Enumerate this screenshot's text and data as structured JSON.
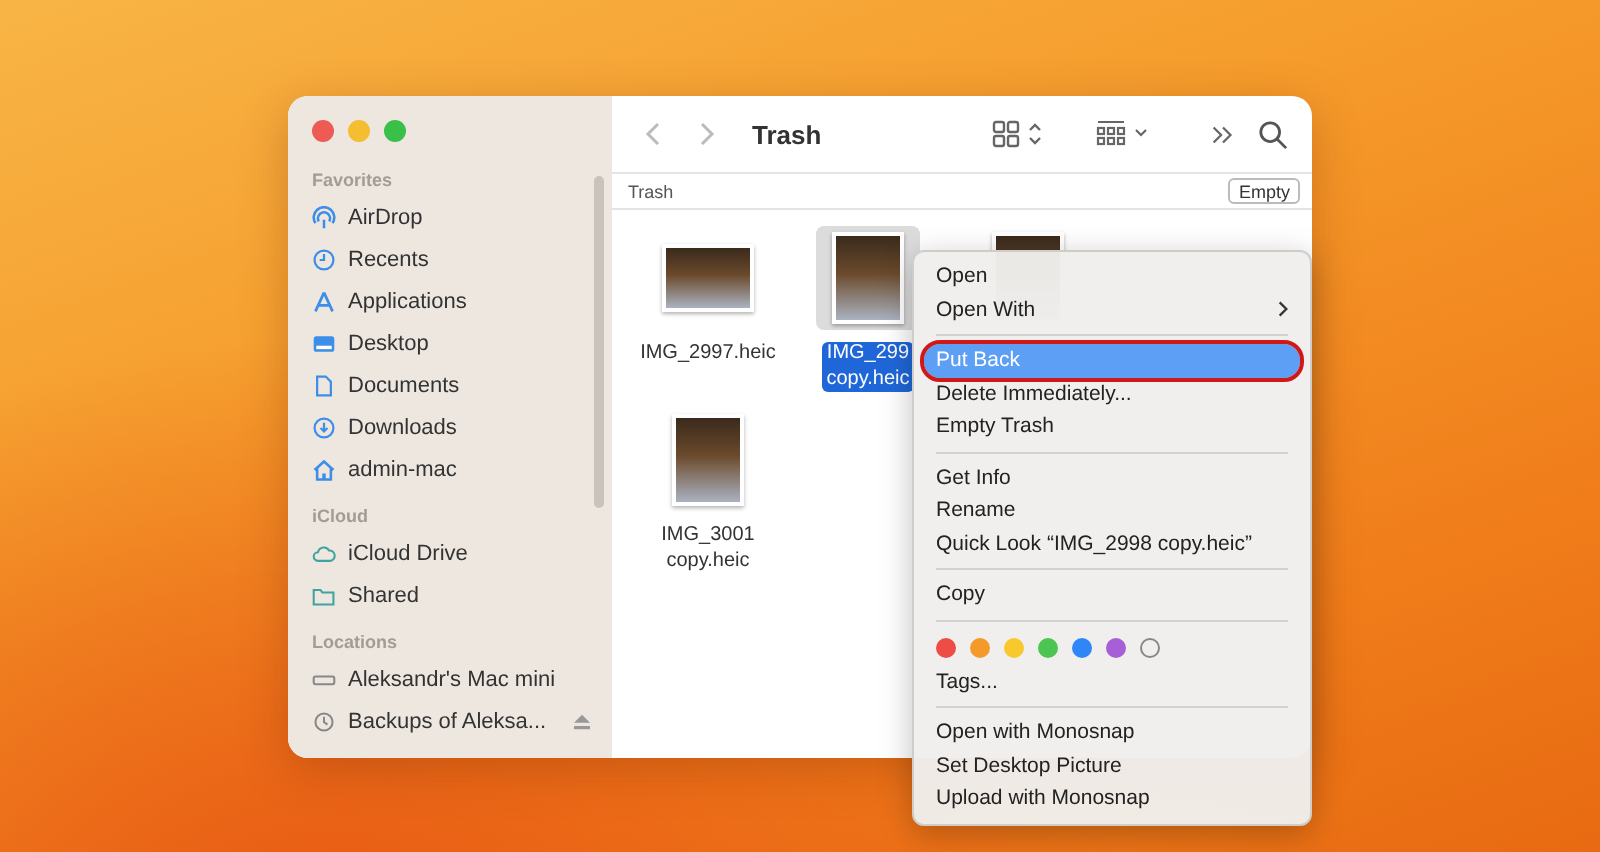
{
  "window": {
    "title": "Trash"
  },
  "sidebar": {
    "sections": [
      {
        "heading": "Favorites",
        "items": [
          {
            "label": "AirDrop"
          },
          {
            "label": "Recents"
          },
          {
            "label": "Applications"
          },
          {
            "label": "Desktop"
          },
          {
            "label": "Documents"
          },
          {
            "label": "Downloads"
          },
          {
            "label": "admin-mac"
          }
        ]
      },
      {
        "heading": "iCloud",
        "items": [
          {
            "label": "iCloud Drive"
          },
          {
            "label": "Shared"
          }
        ]
      },
      {
        "heading": "Locations",
        "items": [
          {
            "label": "Aleksandr's Mac mini",
            "ejectable": false
          },
          {
            "label": "Backups of Aleksa...",
            "ejectable": true
          }
        ]
      }
    ]
  },
  "path_bar": {
    "label": "Trash",
    "button": "Empty"
  },
  "files": [
    {
      "name": "IMG_2997.heic",
      "selected": false
    },
    {
      "name": "IMG_299\ncopy.heic",
      "selected": true
    },
    {
      "selected": false
    },
    {
      "name": "IMG_3001\ncopy.heic",
      "selected": false
    }
  ],
  "context_menu": {
    "sections": [
      [
        {
          "label": "Open",
          "submenu": false,
          "selected": false
        },
        {
          "label": "Open With",
          "submenu": true,
          "selected": false
        }
      ],
      [
        {
          "label": "Put Back",
          "submenu": false,
          "selected": true,
          "circled": true
        },
        {
          "label": "Delete Immediately...",
          "submenu": false,
          "selected": false
        },
        {
          "label": "Empty Trash",
          "submenu": false,
          "selected": false
        }
      ],
      [
        {
          "label": "Get Info",
          "submenu": false,
          "selected": false
        },
        {
          "label": "Rename",
          "submenu": false,
          "selected": false
        },
        {
          "label": "Quick Look “IMG_2998 copy.heic”",
          "submenu": false,
          "selected": false
        }
      ],
      [
        {
          "label": "Copy",
          "submenu": false,
          "selected": false
        }
      ],
      [
        {
          "kind": "tags",
          "dots": [
            {
              "color": "#ec4d45"
            },
            {
              "color": "#f39a2b"
            },
            {
              "color": "#f7c92f"
            },
            {
              "color": "#4cc552"
            },
            {
              "color": "#2f86f6"
            },
            {
              "color": "#a65fd6"
            }
          ],
          "empty_dot": true
        },
        {
          "label": "Tags...",
          "submenu": false,
          "selected": false
        }
      ],
      [
        {
          "label": "Open with Monosnap",
          "submenu": false,
          "selected": false
        },
        {
          "label": "Set Desktop Picture",
          "submenu": false,
          "selected": false
        },
        {
          "label": "Upload with Monosnap",
          "submenu": false,
          "selected": false
        }
      ]
    ]
  }
}
